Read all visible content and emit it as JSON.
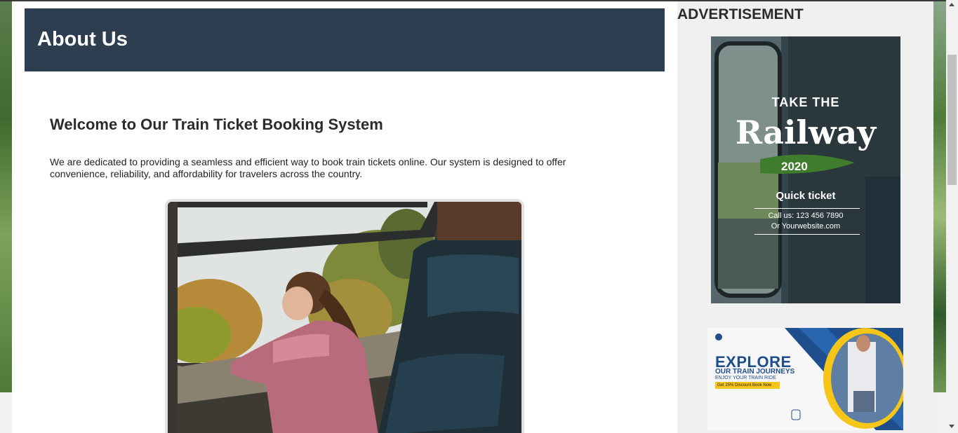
{
  "header": {
    "title": "About Us"
  },
  "content": {
    "heading": "Welcome to Our Train Ticket Booking System",
    "paragraph": "We are dedicated to providing a seamless and efficient way to book train tickets online. Our system is designed to offer convenience, reliability, and affordability for travelers across the country."
  },
  "sidebar": {
    "title": "ADVERTISEMENT",
    "ad1": {
      "line1": "TAKE THE",
      "line2": "Railway",
      "year": "2020",
      "line3": "Quick ticket",
      "line4": "Call us: 123 456 7890",
      "line5": "Or Yourwebsite.com"
    },
    "ad2": {
      "headline": "EXPLORE",
      "sub": "OUR TRAIN JOURNEYS",
      "sub2": "ENJOY YOUR TRAIN RIDE",
      "discount": "Get 25% Discount Book Now"
    }
  }
}
